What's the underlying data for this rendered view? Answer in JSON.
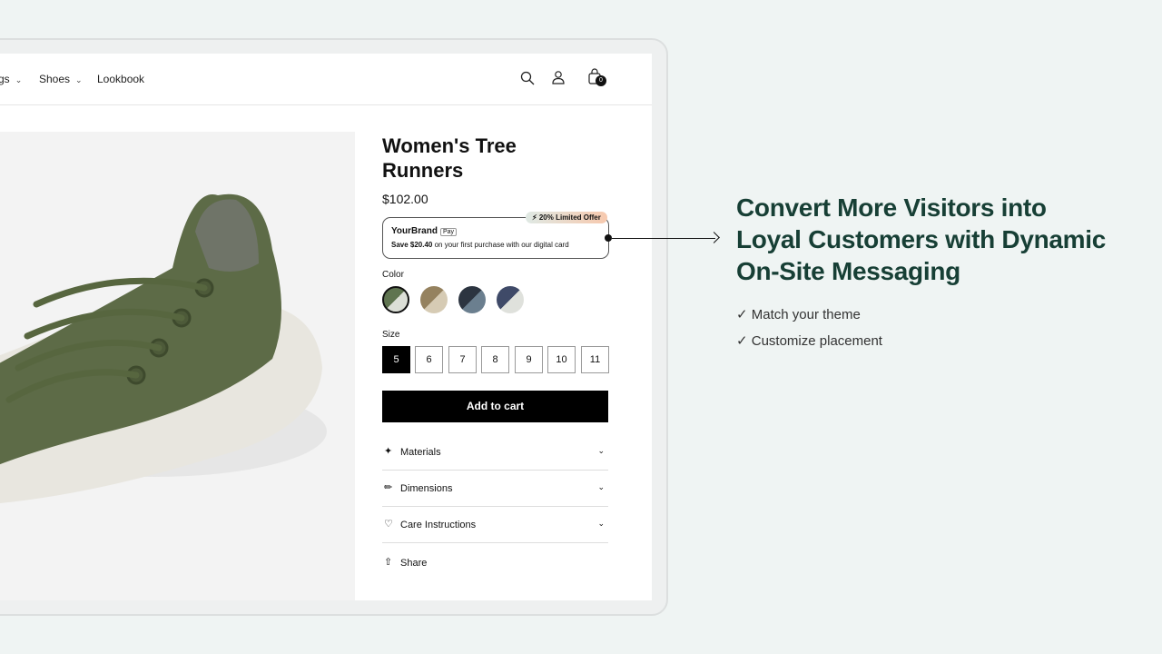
{
  "nav": {
    "items": [
      {
        "label": "gs"
      },
      {
        "label": "Shoes"
      },
      {
        "label": "Lookbook"
      }
    ],
    "cart_count": "0"
  },
  "product": {
    "title": "Women's Tree Runners",
    "price": "$102.00",
    "offer": {
      "brand": "YourBrand",
      "pay_badge": "Pay",
      "tag": "20% Limited Offer",
      "save_amount": "Save $20.40",
      "message": " on your first purchase with our digital card"
    },
    "color_label": "Color",
    "colors": [
      {
        "a": "#5f7450",
        "b": "#dcdfd7",
        "selected": true
      },
      {
        "a": "#95825f",
        "b": "#d6cbb4"
      },
      {
        "a": "#2c3440",
        "b": "#6b7f8f"
      },
      {
        "a": "#3f4a68",
        "b": "#dfe1dc"
      }
    ],
    "size_label": "Size",
    "sizes": [
      "5",
      "6",
      "7",
      "8",
      "9",
      "10",
      "11"
    ],
    "selected_size": "5",
    "add_to_cart": "Add to cart",
    "accordions": [
      {
        "label": "Materials",
        "icon": "leather-icon"
      },
      {
        "label": "Dimensions",
        "icon": "ruler-icon"
      },
      {
        "label": "Care Instructions",
        "icon": "heart-icon"
      }
    ],
    "share": "Share"
  },
  "marketing": {
    "headline": "Convert More Visitors into Loyal Customers with Dynamic On-Site Messaging",
    "features": [
      "Match your theme",
      "Customize placement"
    ]
  },
  "colors": {
    "headline": "#173f35",
    "button": "#000000"
  }
}
